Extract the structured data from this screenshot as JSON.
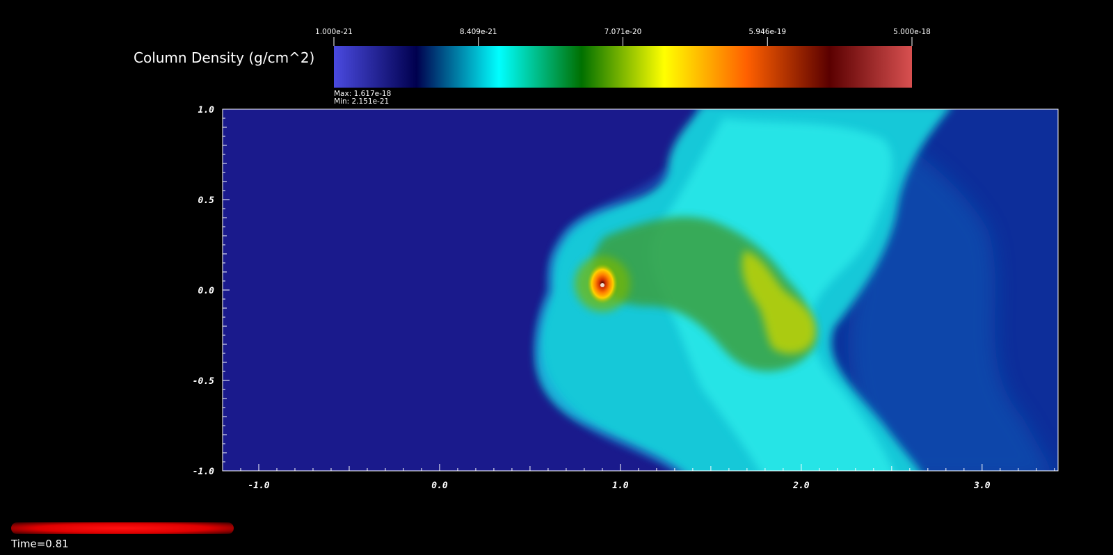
{
  "colorbar": {
    "title": "Column Density (g/cm^2)",
    "tick_labels": [
      "1.000e-21",
      "8.409e-21",
      "7.071e-20",
      "5.946e-19",
      "5.000e-18"
    ],
    "max_label": "Max:  1.617e-18",
    "min_label": "Min:  2.151e-21",
    "colormap": [
      "#4a4ae0",
      "#00004e",
      "#00ffff",
      "#007000",
      "#ffff00",
      "#ff6000",
      "#5a0000",
      "#d85050"
    ]
  },
  "time_label": "Time=0.81",
  "colors": {
    "background": "#000000",
    "empty_region": "#1a1a8c",
    "axis": "#ffffff"
  },
  "chart_data": {
    "type": "heatmap",
    "title": "",
    "xlabel": "",
    "ylabel": "",
    "xlim": [
      -1.2,
      3.42
    ],
    "ylim": [
      -1.0,
      1.0
    ],
    "x_ticks": [
      "-1.0",
      "0.0",
      "1.0",
      "2.0",
      "3.0"
    ],
    "y_ticks": [
      "1.0",
      "0.5",
      "0.0",
      "-0.5",
      "-1.0"
    ],
    "value_range": [
      1e-21,
      5e-18
    ],
    "scale": "log",
    "peak": {
      "x": 0.92,
      "y": 0.02
    }
  }
}
